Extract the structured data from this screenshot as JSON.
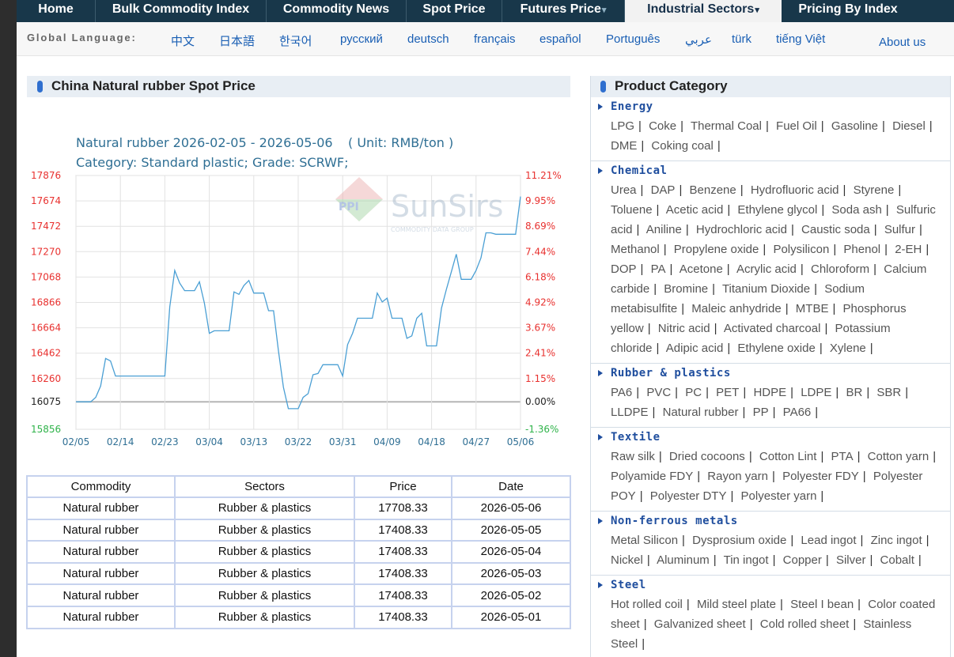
{
  "nav": [
    {
      "label": "Home",
      "caret": ""
    },
    {
      "label": "Bulk Commodity Index",
      "caret": ""
    },
    {
      "label": "Commodity News",
      "caret": ""
    },
    {
      "label": "Spot Price",
      "caret": ""
    },
    {
      "label": "Futures Price",
      "caret": "▾"
    },
    {
      "label": "Industrial Sectors",
      "caret": "▾"
    },
    {
      "label": "Pricing By Index",
      "caret": ""
    }
  ],
  "language_bar": {
    "label": "Global Language:",
    "languages": [
      "中文",
      "日本語",
      "한국어",
      "русский",
      "deutsch",
      "français",
      "español",
      "Português",
      "عربي",
      "türk",
      "tiếng Việt"
    ],
    "about": "About us"
  },
  "left_panel": {
    "title": "China Natural rubber Spot Price"
  },
  "chart_data": {
    "type": "line",
    "title": "Natural rubber 2026-02-05 - 2026-05-06",
    "unit": "( Unit: RMB/ton )",
    "subtitle": "Category: Standard plastic; Grade: SCRWF;",
    "watermark": "SunSirs",
    "watermark_sub": "COMMODITY DATA GROUP",
    "watermark_logo": "PPI",
    "baseline": 16075,
    "y_ticks_left": [
      "17876",
      "17674",
      "17472",
      "17270",
      "17068",
      "16866",
      "16664",
      "16462",
      "16260",
      "16075",
      "15856"
    ],
    "y_ticks_right": [
      "11.21%",
      "9.95%",
      "8.69%",
      "7.44%",
      "6.18%",
      "4.92%",
      "3.67%",
      "2.41%",
      "1.15%",
      "0.00%",
      "-1.36%"
    ],
    "x_ticks": [
      "02/05",
      "02/14",
      "02/23",
      "03/04",
      "03/13",
      "03/22",
      "03/31",
      "04/09",
      "04/18",
      "04/27",
      "05/06"
    ],
    "ylim": [
      15856,
      17876
    ],
    "x_start": "2026-02-05",
    "x_end": "2026-05-06",
    "series": [
      {
        "x": [
          "2026-02-05",
          "2026-02-06",
          "2026-02-07",
          "2026-02-08",
          "2026-02-09",
          "2026-02-10",
          "2026-02-11",
          "2026-02-12",
          "2026-02-13",
          "2026-02-14",
          "2026-02-15",
          "2026-02-16",
          "2026-02-17",
          "2026-02-18",
          "2026-02-19",
          "2026-02-20",
          "2026-02-21",
          "2026-02-22",
          "2026-02-23",
          "2026-02-24",
          "2026-02-25",
          "2026-02-26",
          "2026-02-27",
          "2026-02-28",
          "2026-03-01",
          "2026-03-02",
          "2026-03-03",
          "2026-03-04",
          "2026-03-05",
          "2026-03-06",
          "2026-03-07",
          "2026-03-08",
          "2026-03-09",
          "2026-03-10",
          "2026-03-11",
          "2026-03-12",
          "2026-03-13",
          "2026-03-14",
          "2026-03-15",
          "2026-03-16",
          "2026-03-17",
          "2026-03-18",
          "2026-03-19",
          "2026-03-20",
          "2026-03-21",
          "2026-03-22",
          "2026-03-23",
          "2026-03-24",
          "2026-03-25",
          "2026-03-26",
          "2026-03-27",
          "2026-03-28",
          "2026-03-29",
          "2026-03-30",
          "2026-03-31",
          "2026-04-01",
          "2026-04-02",
          "2026-04-03",
          "2026-04-04",
          "2026-04-05",
          "2026-04-06",
          "2026-04-07",
          "2026-04-08",
          "2026-04-09",
          "2026-04-10",
          "2026-04-11",
          "2026-04-12",
          "2026-04-13",
          "2026-04-14",
          "2026-04-15",
          "2026-04-16",
          "2026-04-17",
          "2026-04-18",
          "2026-04-19",
          "2026-04-20",
          "2026-04-21",
          "2026-04-22",
          "2026-04-23",
          "2026-04-24",
          "2026-04-25",
          "2026-04-26",
          "2026-04-27",
          "2026-04-28",
          "2026-04-29",
          "2026-04-30",
          "2026-05-01",
          "2026-05-02",
          "2026-05-03",
          "2026-05-04",
          "2026-05-05",
          "2026-05-06"
        ],
        "y": [
          16075,
          16075,
          16075,
          16075,
          16110,
          16200,
          16420,
          16400,
          16280,
          16280,
          16280,
          16280,
          16280,
          16280,
          16280,
          16280,
          16280,
          16280,
          16280,
          16830,
          17120,
          17020,
          16960,
          16960,
          16960,
          17030,
          16860,
          16620,
          16640,
          16640,
          16640,
          16640,
          16950,
          16930,
          17000,
          17040,
          16940,
          16940,
          16940,
          16800,
          16800,
          16480,
          16190,
          16020,
          16020,
          16020,
          16110,
          16140,
          16290,
          16300,
          16370,
          16370,
          16370,
          16370,
          16280,
          16530,
          16620,
          16740,
          16740,
          16740,
          16740,
          16940,
          16870,
          16900,
          16740,
          16740,
          16740,
          16580,
          16600,
          16740,
          16780,
          16520,
          16520,
          16520,
          16820,
          16970,
          17110,
          17250,
          17050,
          17050,
          17050,
          17120,
          17220,
          17420,
          17420,
          17408.33,
          17408.33,
          17408.33,
          17408.33,
          17408.33,
          17708.33
        ]
      }
    ]
  },
  "table": {
    "headers": [
      "Commodity",
      "Sectors",
      "Price",
      "Date"
    ],
    "rows": [
      [
        "Natural rubber",
        "Rubber & plastics",
        "17708.33",
        "2026-05-06"
      ],
      [
        "Natural rubber",
        "Rubber & plastics",
        "17408.33",
        "2026-05-05"
      ],
      [
        "Natural rubber",
        "Rubber & plastics",
        "17408.33",
        "2026-05-04"
      ],
      [
        "Natural rubber",
        "Rubber & plastics",
        "17408.33",
        "2026-05-03"
      ],
      [
        "Natural rubber",
        "Rubber & plastics",
        "17408.33",
        "2026-05-02"
      ],
      [
        "Natural rubber",
        "Rubber & plastics",
        "17408.33",
        "2026-05-01"
      ]
    ]
  },
  "right_panel": {
    "title": "Product Category",
    "categories": [
      {
        "name": "Energy",
        "items": [
          "LPG",
          "Coke",
          "Thermal Coal",
          "Fuel Oil",
          "Gasoline",
          "Diesel",
          "DME",
          "Coking coal"
        ]
      },
      {
        "name": "Chemical",
        "items": [
          "Urea",
          "DAP",
          "Benzene",
          "Hydrofluoric acid",
          "Styrene",
          "Toluene",
          "Acetic acid",
          "Ethylene glycol",
          "Soda ash",
          "Sulfuric acid",
          "Aniline",
          "Hydrochloric acid",
          "Caustic soda",
          "Sulfur",
          "Methanol",
          "Propylene oxide",
          "Polysilicon",
          "Phenol",
          "2-EH",
          "DOP",
          "PA",
          "Acetone",
          "Acrylic acid",
          "Chloroform",
          "Calcium carbide",
          "Bromine",
          "Titanium Dioxide",
          "Sodium metabisulfite",
          "Maleic anhydride",
          "MTBE",
          "Phosphorus yellow",
          "Nitric acid",
          "Activated charcoal",
          "Potassium chloride",
          "Adipic acid",
          "Ethylene oxide",
          "Xylene"
        ]
      },
      {
        "name": "Rubber & plastics",
        "items": [
          "PA6",
          "PVC",
          "PC",
          "PET",
          "HDPE",
          "LDPE",
          "BR",
          "SBR",
          "LLDPE",
          "Natural rubber",
          "PP",
          "PA66"
        ]
      },
      {
        "name": "Textile",
        "items": [
          "Raw silk",
          "Dried cocoons",
          "Cotton Lint",
          "PTA",
          "Cotton yarn",
          "Polyamide FDY",
          "Rayon yarn",
          "Polyester FDY",
          "Polyester POY",
          "Polyester DTY",
          "Polyester yarn"
        ]
      },
      {
        "name": "Non-ferrous metals",
        "items": [
          "Metal Silicon",
          "Dysprosium oxide",
          "Lead ingot",
          "Zinc ingot",
          "Nickel",
          "Aluminum",
          "Tin ingot",
          "Copper",
          "Silver",
          "Cobalt"
        ]
      },
      {
        "name": "Steel",
        "items": [
          "Hot rolled coil",
          "Mild steel plate",
          "Steel I bean",
          "Color coated sheet",
          "Galvanized sheet",
          "Cold rolled sheet",
          "Stainless Steel"
        ]
      }
    ]
  },
  "colors": {
    "nav_bg": "#18374a",
    "link": "#1a5fb4",
    "line": "#4a9fd4",
    "axis_up": "#e8312f",
    "axis_down": "#2fb34a",
    "category_title": "#1f4e9e"
  }
}
